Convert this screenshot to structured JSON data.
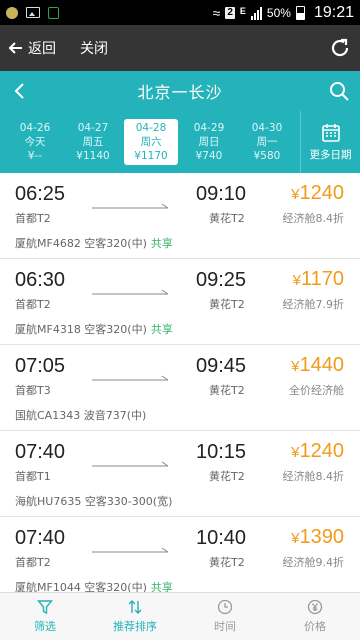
{
  "status_bar": {
    "battery": "50%",
    "time": "19:21",
    "sim": "2",
    "network": "E"
  },
  "nav": {
    "back_label": "返回",
    "close_label": "关闭"
  },
  "header": {
    "title": "北京一长沙"
  },
  "dates": [
    {
      "date": "04-26",
      "day": "今天",
      "price": "¥--"
    },
    {
      "date": "04-27",
      "day": "周五",
      "price": "¥1140"
    },
    {
      "date": "04-28",
      "day": "周六",
      "price": "¥1170",
      "selected": true
    },
    {
      "date": "04-29",
      "day": "周日",
      "price": "¥740"
    },
    {
      "date": "04-30",
      "day": "周一",
      "price": "¥580"
    }
  ],
  "more_dates_label": "更多日期",
  "flights": [
    {
      "dep_time": "06:25",
      "arr_time": "09:10",
      "dep_airport": "首都T2",
      "arr_airport": "黄花T2",
      "price": "1240",
      "cabin": "经济舱8.4折",
      "info": "厦航MF4682 空客320(中)",
      "share": "共享"
    },
    {
      "dep_time": "06:30",
      "arr_time": "09:25",
      "dep_airport": "首都T2",
      "arr_airport": "黄花T2",
      "price": "1170",
      "cabin": "经济舱7.9折",
      "info": "厦航MF4318 空客320(中)",
      "share": "共享"
    },
    {
      "dep_time": "07:05",
      "arr_time": "09:45",
      "dep_airport": "首都T3",
      "arr_airport": "黄花T2",
      "price": "1440",
      "cabin": "全价经济舱",
      "info": "国航CA1343 波音737(中)",
      "share": ""
    },
    {
      "dep_time": "07:40",
      "arr_time": "10:15",
      "dep_airport": "首都T1",
      "arr_airport": "黄花T2",
      "price": "1240",
      "cabin": "经济舱8.4折",
      "info": "海航HU7635 空客330-300(宽)",
      "share": ""
    },
    {
      "dep_time": "07:40",
      "arr_time": "10:40",
      "dep_airport": "首都T2",
      "arr_airport": "黄花T2",
      "price": "1390",
      "cabin": "经济舱9.4折",
      "info": "厦航MF1044 空客320(中)",
      "share": "共享"
    }
  ],
  "currency_symbol": "¥",
  "tabs": [
    {
      "label": "筛选",
      "icon": "filter-icon",
      "active": true
    },
    {
      "label": "推荐排序",
      "icon": "sort-icon",
      "active": true
    },
    {
      "label": "时间",
      "icon": "clock-icon",
      "active": false
    },
    {
      "label": "价格",
      "icon": "yen-icon",
      "active": false
    }
  ],
  "colors": {
    "accent": "#24b3ba",
    "price": "#f39a1b",
    "share": "#3ab36b",
    "nav_bg": "#353535"
  }
}
